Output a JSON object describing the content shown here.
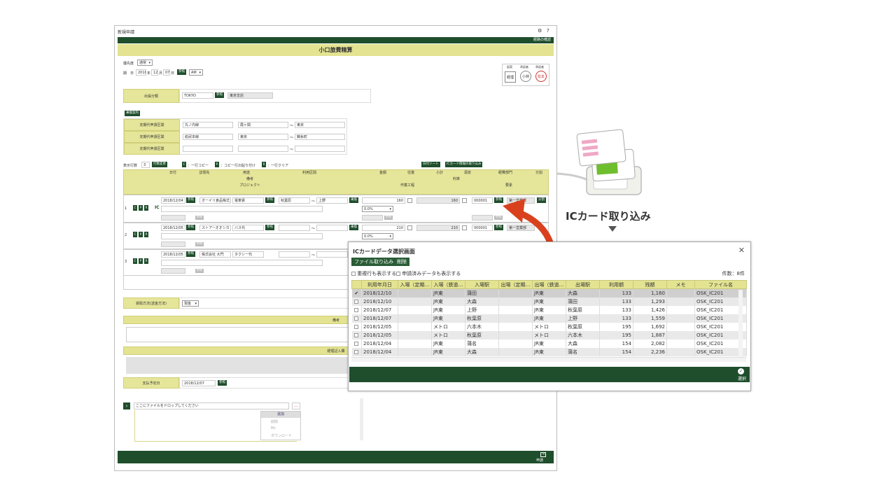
{
  "form": {
    "window_title": "新規申請",
    "route_check": "経路の確認",
    "form_title": "小口旅費精算",
    "priority_label": "優先度",
    "priority_value": "通常",
    "date_label": "期　日",
    "date_year": "2018",
    "date_year_unit": "年",
    "date_month": "12",
    "date_month_unit": "月",
    "date_day": "07",
    "date_day_unit": "日",
    "ref_label": "参照",
    "ampm_value": "AM",
    "seals": {
      "h1": "起案",
      "h2": "承認者",
      "h3": "承認者",
      "s1": "経理",
      "s2": "小林",
      "s3": "松本"
    },
    "dept_label": "出張分類",
    "dept_code": "TOKYO",
    "dept_name": "東京支店",
    "commute_btn": "乗換案内",
    "commute_label": "定期代申請区間",
    "commute_rows": [
      {
        "a": "丸ノ内線",
        "b": "霞ヶ関",
        "c": "東京"
      },
      {
        "a": "総武本線",
        "b": "東京",
        "c": "錦糸町"
      },
      {
        "a": "",
        "b": "",
        "c": ""
      }
    ],
    "tilde": "〜",
    "rowcount_label": "表示行数",
    "rowcount_value": "3",
    "rowchange_btn": "行数変更",
    "legend_c": "C",
    "legend_c_text": "：一行コピー",
    "legend_p": "P",
    "legend_p_text": "：コピー行の貼り付け",
    "legend_r": "R",
    "legend_r_text": "：一行クリア",
    "daily_btn": "日付ソート",
    "icread_btn": "ICカード情報の取り込み",
    "cols1": [
      "日付",
      "訪問先",
      "用途",
      "利用区間",
      "金額",
      "往復",
      "小計",
      "源泉",
      "経費部門",
      "分割"
    ],
    "cols2": [
      "備考",
      "利率"
    ],
    "cols3": [
      "プロジェクト",
      "作業工程",
      "要素"
    ],
    "rows": [
      {
        "no": "1",
        "date": "2018/12/04",
        "dest": "オーイリ食品株式",
        "use": "電車賃",
        "from": "秋葉原",
        "to": "上野",
        "amount": "160",
        "sub": "160",
        "dept": "000001",
        "deptname": "第一営業部",
        "rate": "0.0%"
      },
      {
        "no": "2",
        "date": "2018/12/05",
        "dest": "ストアーオオシカ",
        "use": "バス代",
        "from": "",
        "to": "",
        "amount": "210",
        "sub": "210",
        "dept": "000001",
        "deptname": "第一営業部",
        "rate": "0.0%"
      },
      {
        "no": "3",
        "date": "2018/12/05",
        "dest": "株式会社 大門",
        "use": "タクシー代",
        "from": "",
        "to": "",
        "amount": "",
        "sub": "",
        "dept": "",
        "deptname": "",
        "rate": ""
      }
    ],
    "ic_mark": "IC",
    "transit_btn": "乗換",
    "split_btn": "分割",
    "c_btn": "C",
    "p_btn": "P",
    "r_btn": "R",
    "payment_label": "受取方法(送金方法)",
    "payment_value": "現金",
    "memo_label": "備考",
    "acct_label": "経理記入欄",
    "paydate_label": "支払予定日",
    "paydate_value": "2018/12/07",
    "file_placeholder": "ここにファイルをドロップしてください",
    "file_menu": [
      "追加",
      "削除",
      "Mc",
      "ダウンロード"
    ],
    "submit_label": "申請"
  },
  "ic_panel": {
    "title": "ICカード取り込み",
    "dialog_title": "ICカードデータ選択画面",
    "file_btn": "ファイル取り込み",
    "delete_btn": "削除",
    "opt1": "重複行も表示する",
    "opt2": "申請済みデータも表示する",
    "count": "件数：8件",
    "headers": [
      "",
      "利用年月日",
      "入場（定期…",
      "入場（鉄道…",
      "入場駅",
      "出場（定期…",
      "出場（鉄道…",
      "出場駅",
      "利用額",
      "残額",
      "メモ",
      "ファイル名"
    ],
    "rows": [
      {
        "check": "✔",
        "date": "2018/12/10",
        "in_line": "JR東",
        "in_st": "蒲田",
        "out_line": "JR東",
        "out_st": "大森",
        "amt": "133",
        "bal": "1,160",
        "file": "OSK_IC201"
      },
      {
        "check": "",
        "date": "2018/12/10",
        "in_line": "JR東",
        "in_st": "大森",
        "out_line": "JR東",
        "out_st": "蒲田",
        "amt": "133",
        "bal": "1,293",
        "file": "OSK_IC201"
      },
      {
        "check": "",
        "date": "2018/12/07",
        "in_line": "JR東",
        "in_st": "上野",
        "out_line": "JR東",
        "out_st": "秋葉原",
        "amt": "133",
        "bal": "1,426",
        "file": "OSK_IC201"
      },
      {
        "check": "",
        "date": "2018/12/07",
        "in_line": "JR東",
        "in_st": "秋葉原",
        "out_line": "JR東",
        "out_st": "上野",
        "amt": "133",
        "bal": "1,559",
        "file": "OSK_IC201"
      },
      {
        "check": "",
        "date": "2018/12/05",
        "in_line": "メトロ",
        "in_st": "六本木",
        "out_line": "メトロ",
        "out_st": "秋葉原",
        "amt": "195",
        "bal": "1,692",
        "file": "OSK_IC201"
      },
      {
        "check": "",
        "date": "2018/12/05",
        "in_line": "メトロ",
        "in_st": "秋葉原",
        "out_line": "メトロ",
        "out_st": "六本木",
        "amt": "195",
        "bal": "1,887",
        "file": "OSK_IC201"
      },
      {
        "check": "",
        "date": "2018/12/04",
        "in_line": "JR東",
        "in_st": "蒲名",
        "out_line": "JR東",
        "out_st": "大森",
        "amt": "154",
        "bal": "2,082",
        "file": "OSK_IC201"
      },
      {
        "check": "",
        "date": "2018/12/04",
        "in_line": "JR東",
        "in_st": "大森",
        "out_line": "JR東",
        "out_st": "蒲名",
        "amt": "154",
        "bal": "2,236",
        "file": "OSK_IC201"
      }
    ],
    "select_label": "選択"
  },
  "colors": {
    "dark_green": "#1f4e2c",
    "olive": "#e3e392",
    "arrow_red": "#d9411e"
  }
}
